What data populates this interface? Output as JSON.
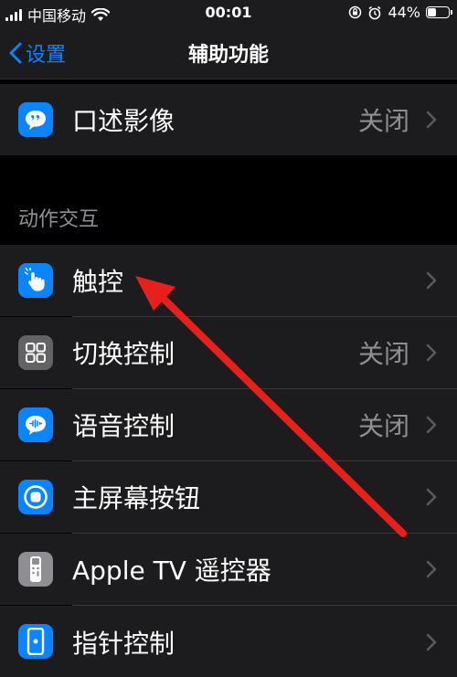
{
  "status": {
    "carrier": "中国移动",
    "time": "00:01",
    "battery": "44%",
    "battery_level": 0.44
  },
  "nav": {
    "back_label": "设置",
    "title": "辅助功能"
  },
  "top_item": {
    "label": "口述影像",
    "value": "关闭"
  },
  "section": {
    "header": "动作交互"
  },
  "items": [
    {
      "label": "触控",
      "value": ""
    },
    {
      "label": "切换控制",
      "value": "关闭"
    },
    {
      "label": "语音控制",
      "value": "关闭"
    },
    {
      "label": "主屏幕按钮",
      "value": ""
    },
    {
      "label": "Apple TV 遥控器",
      "value": ""
    },
    {
      "label": "指针控制",
      "value": ""
    }
  ],
  "colors": {
    "accent": "#0a84ff",
    "icon_blue": "#0a84ff",
    "icon_gray": "#636366",
    "annotation_arrow": "#e8201c"
  },
  "icons": [
    "audio-description-icon",
    "touch-hand-icon",
    "switch-control-icon",
    "voice-control-icon",
    "home-button-icon",
    "apple-tv-remote-icon",
    "pointer-control-icon"
  ]
}
